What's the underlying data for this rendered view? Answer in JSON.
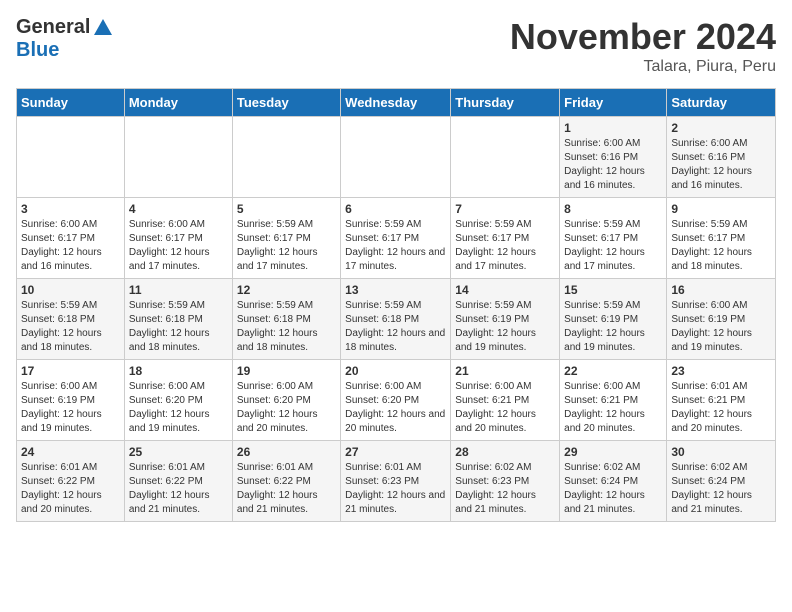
{
  "logo": {
    "general": "General",
    "blue": "Blue"
  },
  "title": "November 2024",
  "location": "Talara, Piura, Peru",
  "days_of_week": [
    "Sunday",
    "Monday",
    "Tuesday",
    "Wednesday",
    "Thursday",
    "Friday",
    "Saturday"
  ],
  "weeks": [
    [
      {
        "day": "",
        "info": ""
      },
      {
        "day": "",
        "info": ""
      },
      {
        "day": "",
        "info": ""
      },
      {
        "day": "",
        "info": ""
      },
      {
        "day": "",
        "info": ""
      },
      {
        "day": "1",
        "info": "Sunrise: 6:00 AM\nSunset: 6:16 PM\nDaylight: 12 hours and 16 minutes."
      },
      {
        "day": "2",
        "info": "Sunrise: 6:00 AM\nSunset: 6:16 PM\nDaylight: 12 hours and 16 minutes."
      }
    ],
    [
      {
        "day": "3",
        "info": "Sunrise: 6:00 AM\nSunset: 6:17 PM\nDaylight: 12 hours and 16 minutes."
      },
      {
        "day": "4",
        "info": "Sunrise: 6:00 AM\nSunset: 6:17 PM\nDaylight: 12 hours and 17 minutes."
      },
      {
        "day": "5",
        "info": "Sunrise: 5:59 AM\nSunset: 6:17 PM\nDaylight: 12 hours and 17 minutes."
      },
      {
        "day": "6",
        "info": "Sunrise: 5:59 AM\nSunset: 6:17 PM\nDaylight: 12 hours and 17 minutes."
      },
      {
        "day": "7",
        "info": "Sunrise: 5:59 AM\nSunset: 6:17 PM\nDaylight: 12 hours and 17 minutes."
      },
      {
        "day": "8",
        "info": "Sunrise: 5:59 AM\nSunset: 6:17 PM\nDaylight: 12 hours and 17 minutes."
      },
      {
        "day": "9",
        "info": "Sunrise: 5:59 AM\nSunset: 6:17 PM\nDaylight: 12 hours and 18 minutes."
      }
    ],
    [
      {
        "day": "10",
        "info": "Sunrise: 5:59 AM\nSunset: 6:18 PM\nDaylight: 12 hours and 18 minutes."
      },
      {
        "day": "11",
        "info": "Sunrise: 5:59 AM\nSunset: 6:18 PM\nDaylight: 12 hours and 18 minutes."
      },
      {
        "day": "12",
        "info": "Sunrise: 5:59 AM\nSunset: 6:18 PM\nDaylight: 12 hours and 18 minutes."
      },
      {
        "day": "13",
        "info": "Sunrise: 5:59 AM\nSunset: 6:18 PM\nDaylight: 12 hours and 18 minutes."
      },
      {
        "day": "14",
        "info": "Sunrise: 5:59 AM\nSunset: 6:19 PM\nDaylight: 12 hours and 19 minutes."
      },
      {
        "day": "15",
        "info": "Sunrise: 5:59 AM\nSunset: 6:19 PM\nDaylight: 12 hours and 19 minutes."
      },
      {
        "day": "16",
        "info": "Sunrise: 6:00 AM\nSunset: 6:19 PM\nDaylight: 12 hours and 19 minutes."
      }
    ],
    [
      {
        "day": "17",
        "info": "Sunrise: 6:00 AM\nSunset: 6:19 PM\nDaylight: 12 hours and 19 minutes."
      },
      {
        "day": "18",
        "info": "Sunrise: 6:00 AM\nSunset: 6:20 PM\nDaylight: 12 hours and 19 minutes."
      },
      {
        "day": "19",
        "info": "Sunrise: 6:00 AM\nSunset: 6:20 PM\nDaylight: 12 hours and 20 minutes."
      },
      {
        "day": "20",
        "info": "Sunrise: 6:00 AM\nSunset: 6:20 PM\nDaylight: 12 hours and 20 minutes."
      },
      {
        "day": "21",
        "info": "Sunrise: 6:00 AM\nSunset: 6:21 PM\nDaylight: 12 hours and 20 minutes."
      },
      {
        "day": "22",
        "info": "Sunrise: 6:00 AM\nSunset: 6:21 PM\nDaylight: 12 hours and 20 minutes."
      },
      {
        "day": "23",
        "info": "Sunrise: 6:01 AM\nSunset: 6:21 PM\nDaylight: 12 hours and 20 minutes."
      }
    ],
    [
      {
        "day": "24",
        "info": "Sunrise: 6:01 AM\nSunset: 6:22 PM\nDaylight: 12 hours and 20 minutes."
      },
      {
        "day": "25",
        "info": "Sunrise: 6:01 AM\nSunset: 6:22 PM\nDaylight: 12 hours and 21 minutes."
      },
      {
        "day": "26",
        "info": "Sunrise: 6:01 AM\nSunset: 6:22 PM\nDaylight: 12 hours and 21 minutes."
      },
      {
        "day": "27",
        "info": "Sunrise: 6:01 AM\nSunset: 6:23 PM\nDaylight: 12 hours and 21 minutes."
      },
      {
        "day": "28",
        "info": "Sunrise: 6:02 AM\nSunset: 6:23 PM\nDaylight: 12 hours and 21 minutes."
      },
      {
        "day": "29",
        "info": "Sunrise: 6:02 AM\nSunset: 6:24 PM\nDaylight: 12 hours and 21 minutes."
      },
      {
        "day": "30",
        "info": "Sunrise: 6:02 AM\nSunset: 6:24 PM\nDaylight: 12 hours and 21 minutes."
      }
    ]
  ]
}
